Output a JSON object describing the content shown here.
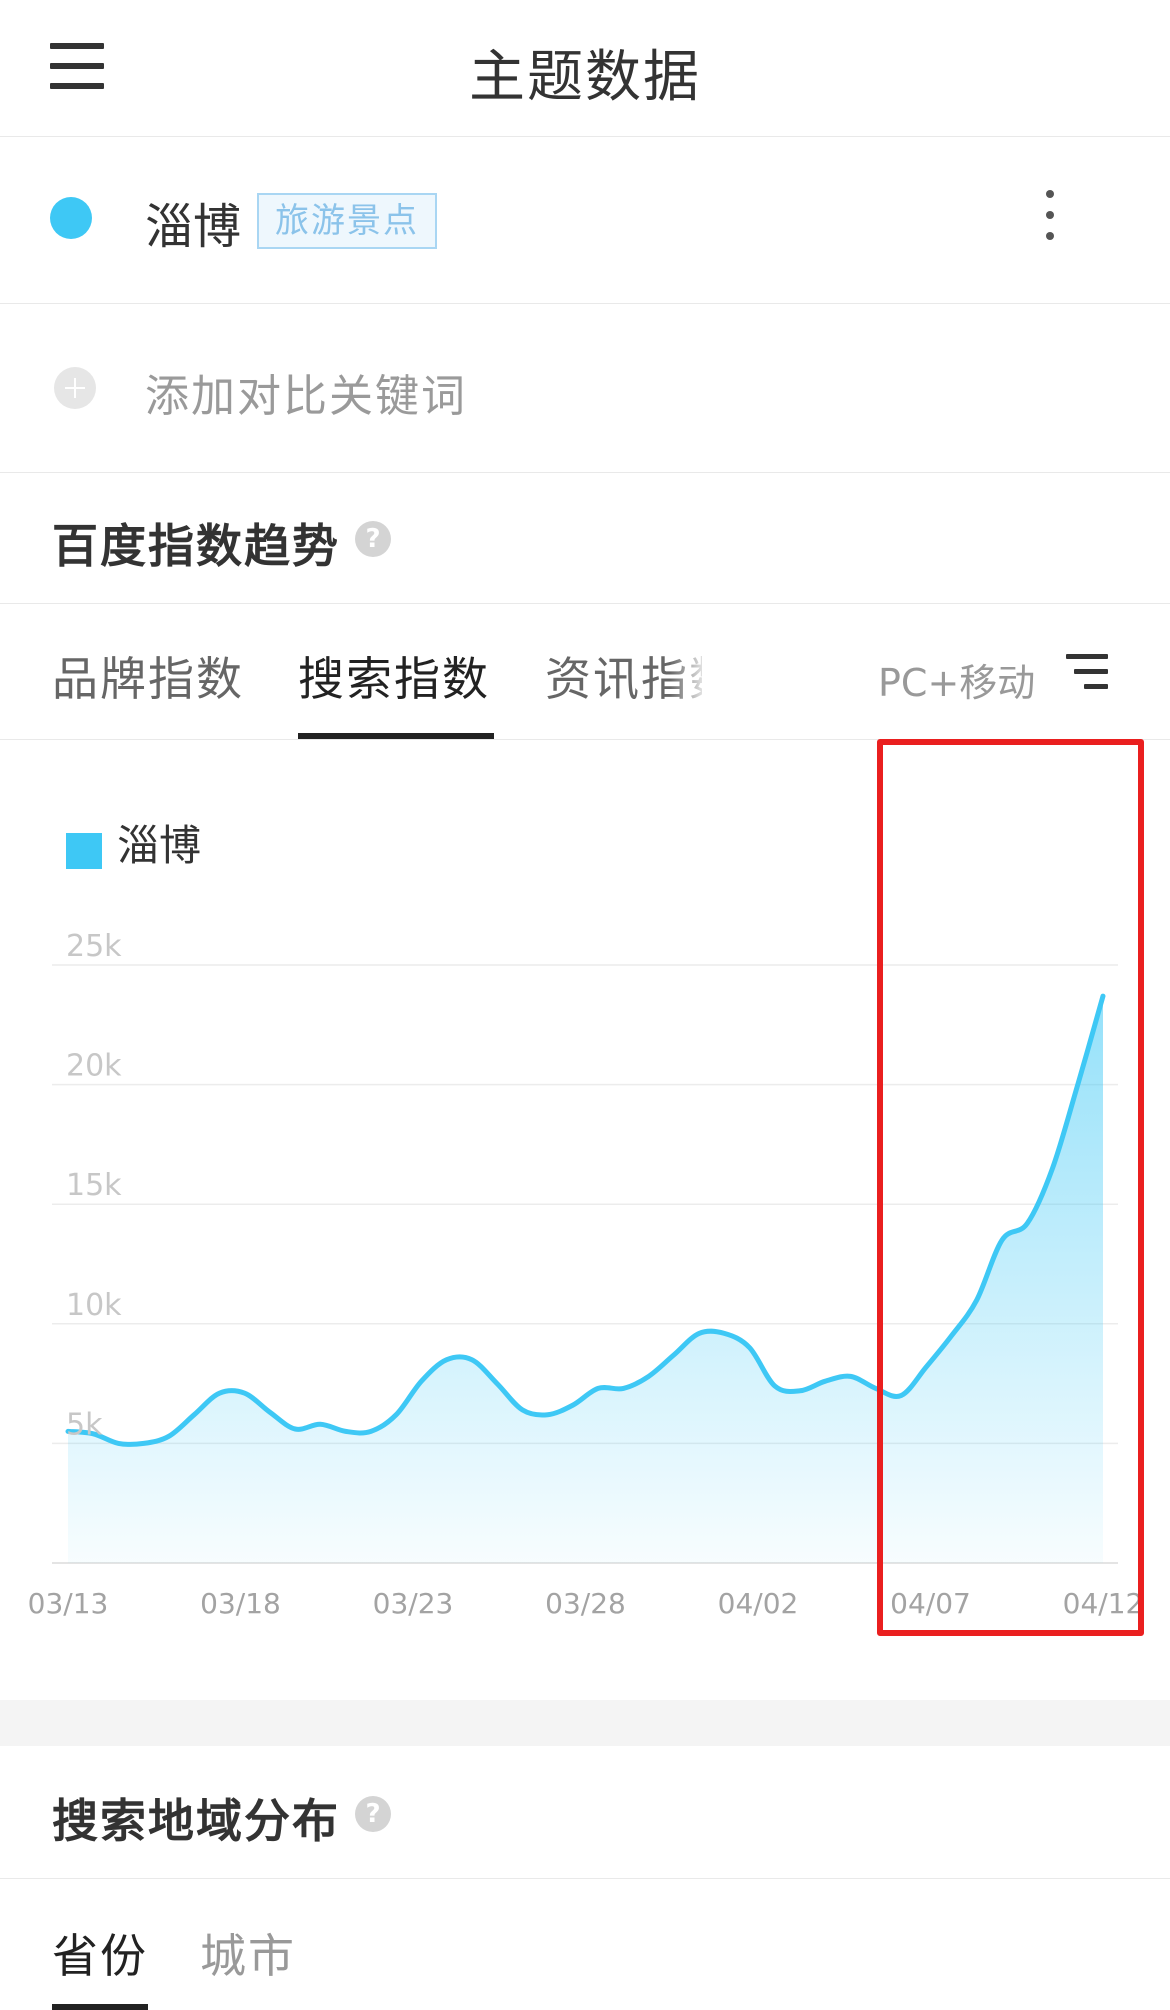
{
  "header": {
    "title": "主题数据",
    "menu_icon": "hamburger-menu-icon"
  },
  "keyword": {
    "name": "淄博",
    "tag": "旅游景点",
    "dot_color": "#3ec8f5",
    "more_icon": "vertical-ellipsis-icon"
  },
  "compare": {
    "label": "添加对比关键词",
    "icon": "plus-circle-icon"
  },
  "trend_section": {
    "title": "百度指数趋势",
    "help_icon": "question-icon",
    "help_glyph": "?"
  },
  "tabs": [
    {
      "label": "品牌指数",
      "active": false
    },
    {
      "label": "搜索指数",
      "active": true
    },
    {
      "label": "资讯指数",
      "active": false
    }
  ],
  "device": {
    "label": "PC+移动",
    "icon": "filter-icon"
  },
  "chart_data": {
    "type": "area",
    "series": [
      {
        "name": "淄博",
        "color": "#3ec8f5",
        "values": [
          5500,
          5400,
          5000,
          5000,
          5300,
          6200,
          7100,
          7100,
          6300,
          5600,
          5800,
          5500,
          5500,
          6200,
          7600,
          8500,
          8500,
          7500,
          6400,
          6200,
          6600,
          7300,
          7300,
          7800,
          8700,
          9600,
          9600,
          9000,
          7400,
          7200,
          7600,
          7800,
          7300,
          7000,
          8200,
          9500,
          11000,
          13500,
          14200,
          16500,
          20000,
          23700
        ]
      }
    ],
    "x_start": "03/13",
    "x_end": "04/12",
    "x_tick_labels": [
      "03/13",
      "03/18",
      "03/23",
      "03/28",
      "04/02",
      "04/07",
      "04/12"
    ],
    "y_tick_labels": [
      "5k",
      "10k",
      "15k",
      "20k",
      "25k"
    ],
    "ylim": [
      0,
      25000
    ],
    "grid": true,
    "legend": "top-left",
    "title": "",
    "xlabel": "",
    "ylabel": ""
  },
  "region_section": {
    "title": "搜索地域分布",
    "help_icon": "question-icon",
    "help_glyph": "?"
  },
  "region_tabs": [
    {
      "label": "省份",
      "active": true
    },
    {
      "label": "城市",
      "active": false
    }
  ]
}
